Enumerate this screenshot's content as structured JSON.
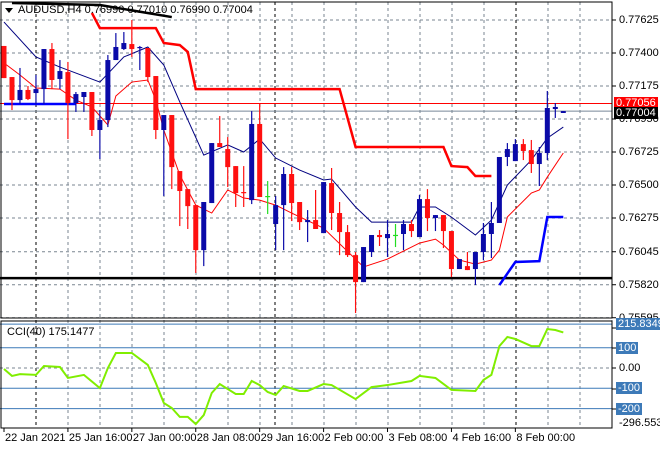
{
  "header": {
    "symbol_title": "AUDUSD,H4",
    "ohlc": "0.76990 0.77010 0.76990 0.77004"
  },
  "colors": {
    "bull": "#0a0aa8",
    "bear": "#ff1010",
    "doji": "#22dd22",
    "ma_fast": "#000080",
    "ma_slow": "#ff0000",
    "cci": "#80ee00",
    "level": "#3d7ab8",
    "grid": "#7a8590"
  },
  "price_axis": {
    "ticks": [
      "0.77625",
      "0.77400",
      "0.77175",
      "0.76950",
      "0.76725",
      "0.76500",
      "0.76275",
      "0.76045",
      "0.75820",
      "0.75595"
    ],
    "tick_values": [
      0.77625,
      0.774,
      0.77175,
      0.7695,
      0.76725,
      0.765,
      0.76275,
      0.76045,
      0.7582,
      0.75595
    ],
    "ask_line": {
      "label": "0.77056",
      "value": 0.77056
    },
    "bid_line": {
      "label": "0.77004",
      "value": 0.77004
    },
    "support_line": 0.75865
  },
  "candles": [
    [
      0.77448,
      0.77448,
      0.77229,
      0.77229
    ],
    [
      0.77236,
      0.77236,
      0.77011,
      0.77079
    ],
    [
      0.77079,
      0.77298,
      0.77052,
      0.77148
    ],
    [
      0.77148,
      0.77175,
      0.77079,
      0.77086
    ],
    [
      0.77127,
      0.7725,
      0.77052,
      0.77154
    ],
    [
      0.77154,
      0.77427,
      0.77052,
      0.77427
    ],
    [
      0.77427,
      0.77468,
      0.77154,
      0.77216
    ],
    [
      0.77223,
      0.77352,
      0.77154,
      0.77277
    ],
    [
      0.7727,
      0.77339,
      0.76813,
      0.77059
    ],
    [
      0.77059,
      0.77134,
      0.76998,
      0.7712
    ],
    [
      0.771,
      0.77134,
      0.76998,
      0.77134
    ],
    [
      0.77134,
      0.77134,
      0.76834,
      0.76875
    ],
    [
      0.76875,
      0.77011,
      0.76677,
      0.76943
    ],
    [
      0.76943,
      0.77386,
      0.76895,
      0.77352
    ],
    [
      0.77352,
      0.77536,
      0.77352,
      0.77441
    ],
    [
      0.77427,
      0.77543,
      0.7742,
      0.77468
    ],
    [
      0.77461,
      0.77625,
      0.77373,
      0.77427
    ],
    [
      0.77434,
      0.77448,
      0.77284,
      0.77441
    ],
    [
      0.77434,
      0.77434,
      0.77202,
      0.77236
    ],
    [
      0.77243,
      0.77243,
      0.76813,
      0.76875
    ],
    [
      0.76875,
      0.76977,
      0.76425,
      0.76977
    ],
    [
      0.76977,
      0.76977,
      0.76472,
      0.76622
    ],
    [
      0.76595,
      0.76595,
      0.7622,
      0.76459
    ],
    [
      0.76472,
      0.76472,
      0.762,
      0.76356
    ],
    [
      0.76363,
      0.76363,
      0.759,
      0.76056
    ],
    [
      0.76056,
      0.76384,
      0.75947,
      0.76384
    ],
    [
      0.76377,
      0.76786,
      0.76377,
      0.76786
    ],
    [
      0.76786,
      0.7697,
      0.76759,
      0.76759
    ],
    [
      0.76745,
      0.76827,
      0.76486,
      0.76622
    ],
    [
      0.76629,
      0.76629,
      0.7635,
      0.76445
    ],
    [
      0.76452,
      0.76629,
      0.7635,
      0.76445
    ],
    [
      0.76397,
      0.77004,
      0.7637,
      0.76916
    ],
    [
      0.76916,
      0.77052,
      0.76418,
      0.76418
    ],
    [
      0.76425,
      0.76527,
      0.76302,
      0.76425
    ],
    [
      0.76234,
      0.76425,
      0.76056,
      0.76363
    ],
    [
      0.76363,
      0.76622,
      0.76056,
      0.76575
    ],
    [
      0.76575,
      0.76622,
      0.76254,
      0.76377
    ],
    [
      0.76384,
      0.76384,
      0.76193,
      0.76247
    ],
    [
      0.76247,
      0.76329,
      0.76111,
      0.76261
    ],
    [
      0.76261,
      0.76466,
      0.762,
      0.762
    ],
    [
      0.76172,
      0.7652,
      0.76172,
      0.7652
    ],
    [
      0.76513,
      0.76616,
      0.76193,
      0.76309
    ],
    [
      0.76309,
      0.76384,
      0.76022,
      0.76179
    ],
    [
      0.76179,
      0.76227,
      0.76009,
      0.76022
    ],
    [
      0.76022,
      0.76043,
      0.75627,
      0.75838
    ],
    [
      0.75838,
      0.76077,
      0.75838,
      0.76077
    ],
    [
      0.76043,
      0.76159,
      0.76009,
      0.76159
    ],
    [
      0.76159,
      0.76193,
      0.76084,
      0.76145
    ],
    [
      0.76138,
      0.76261,
      0.76009,
      0.76166
    ],
    [
      0.7616,
      0.76234,
      0.76077,
      0.7616
    ],
    [
      0.76166,
      0.76261,
      0.76056,
      0.76234
    ],
    [
      0.76234,
      0.76261,
      0.76145,
      0.76186
    ],
    [
      0.76145,
      0.76432,
      0.76145,
      0.76404
    ],
    [
      0.76404,
      0.76472,
      0.76186,
      0.76275
    ],
    [
      0.76275,
      0.76295,
      0.76186,
      0.76295
    ],
    [
      0.76295,
      0.76295,
      0.7607,
      0.76186
    ],
    [
      0.76186,
      0.76186,
      0.75872,
      0.75927
    ],
    [
      0.75927,
      0.75995,
      0.75927,
      0.75995
    ],
    [
      0.75947,
      0.76043,
      0.7592,
      0.7592
    ],
    [
      0.75927,
      0.76043,
      0.75818,
      0.76043
    ],
    [
      0.76043,
      0.76241,
      0.75988,
      0.76166
    ],
    [
      0.76166,
      0.76384,
      0.76002,
      0.76241
    ],
    [
      0.76241,
      0.76691,
      0.76241,
      0.76691
    ],
    [
      0.76691,
      0.76786,
      0.76629,
      0.76745
    ],
    [
      0.76663,
      0.76813,
      0.76663,
      0.76779
    ],
    [
      0.76779,
      0.76813,
      0.7667,
      0.76732
    ],
    [
      0.76738,
      0.76807,
      0.76582,
      0.76643
    ],
    [
      0.76643,
      0.76759,
      0.76493,
      0.76718
    ],
    [
      0.76718,
      0.77141,
      0.7667,
      0.77025
    ],
    [
      0.77018,
      0.77059,
      0.76957,
      0.77032
    ],
    [
      0.76991,
      0.77004,
      0.76991,
      0.77004
    ]
  ],
  "ma_fast": [
    [
      0,
      0.77611
    ],
    [
      4,
      0.77373
    ],
    [
      7,
      0.77304
    ],
    [
      12,
      0.77202
    ],
    [
      15,
      0.77373
    ],
    [
      18,
      0.77441
    ],
    [
      20,
      0.77318
    ],
    [
      22,
      0.77066
    ],
    [
      25,
      0.76704
    ],
    [
      28,
      0.76773
    ],
    [
      30,
      0.76725
    ],
    [
      32,
      0.76813
    ],
    [
      34,
      0.76684
    ],
    [
      37,
      0.76602
    ],
    [
      40,
      0.76534
    ],
    [
      41,
      0.76541
    ],
    [
      44,
      0.7635
    ],
    [
      46,
      0.76247
    ],
    [
      51,
      0.76247
    ],
    [
      52,
      0.7635
    ],
    [
      54,
      0.7635
    ],
    [
      56,
      0.76281
    ],
    [
      59,
      0.76159
    ],
    [
      61,
      0.76261
    ],
    [
      63,
      0.765
    ],
    [
      66,
      0.7667
    ],
    [
      68,
      0.7682
    ],
    [
      70,
      0.76895
    ]
  ],
  "ma_slow": [
    [
      0,
      0.77332
    ],
    [
      2,
      0.7725
    ],
    [
      4,
      0.77161
    ],
    [
      7,
      0.77154
    ],
    [
      9,
      0.77079
    ],
    [
      11,
      0.77032
    ],
    [
      13,
      0.76909
    ],
    [
      14,
      0.77107
    ],
    [
      16,
      0.77202
    ],
    [
      18,
      0.77216
    ],
    [
      19,
      0.77079
    ],
    [
      20,
      0.76875
    ],
    [
      22,
      0.76568
    ],
    [
      24,
      0.76363
    ],
    [
      26,
      0.76309
    ],
    [
      28,
      0.76466
    ],
    [
      30,
      0.76411
    ],
    [
      32,
      0.76397
    ],
    [
      34,
      0.76363
    ],
    [
      36,
      0.76309
    ],
    [
      40,
      0.76206
    ],
    [
      45,
      0.75941
    ],
    [
      48,
      0.75995
    ],
    [
      52,
      0.76104
    ],
    [
      54,
      0.76131
    ],
    [
      55,
      0.76091
    ],
    [
      57,
      0.75988
    ],
    [
      59,
      0.75961
    ],
    [
      61,
      0.75988
    ],
    [
      62,
      0.76056
    ],
    [
      63,
      0.76282
    ],
    [
      66,
      0.76445
    ],
    [
      67,
      0.76466
    ],
    [
      68,
      0.76554
    ],
    [
      70,
      0.76718
    ]
  ],
  "resistance_steps": [
    [
      11,
      0.77673
    ],
    [
      12,
      0.7757
    ],
    [
      19,
      0.7757
    ],
    [
      20,
      0.77468
    ],
    [
      22,
      0.77454
    ],
    [
      23,
      0.77407
    ],
    [
      24,
      0.77154
    ],
    [
      42,
      0.77154
    ],
    [
      44,
      0.76759
    ],
    [
      55,
      0.76759
    ],
    [
      56,
      0.76629
    ],
    [
      58,
      0.76622
    ],
    [
      59,
      0.76561
    ],
    [
      61,
      0.76561
    ]
  ],
  "support_steps_left": [
    [
      0,
      0.77052
    ],
    [
      9,
      0.77052
    ]
  ],
  "support_steps_right": [
    [
      62,
      0.75818
    ],
    [
      64,
      0.75975
    ],
    [
      67,
      0.75981
    ],
    [
      68,
      0.76282
    ],
    [
      70,
      0.76282
    ]
  ],
  "zigzag": [
    [
      1,
      0.77741
    ],
    [
      12,
      0.77727
    ],
    [
      21,
      0.77645
    ]
  ],
  "cci": {
    "title": "CCI(40) 175.1477",
    "axis_labels": {
      "max": "215.8349",
      "p100": "100",
      "zero": "0.00",
      "m100": "-100",
      "m200": "-200",
      "min": "-296.553"
    },
    "levels": [
      215.8349,
      100,
      -100,
      -200
    ],
    "points": [
      [
        0,
        -5
      ],
      [
        1,
        -39
      ],
      [
        2,
        -30
      ],
      [
        4,
        -34
      ],
      [
        5,
        10
      ],
      [
        7,
        5
      ],
      [
        8,
        -49
      ],
      [
        10,
        -34
      ],
      [
        12,
        -99
      ],
      [
        13,
        0
      ],
      [
        14,
        74
      ],
      [
        16,
        74
      ],
      [
        18,
        15
      ],
      [
        19,
        -74
      ],
      [
        20,
        -172
      ],
      [
        21,
        -197
      ],
      [
        22,
        -241
      ],
      [
        23,
        -241
      ],
      [
        24,
        -276
      ],
      [
        25,
        -232
      ],
      [
        26,
        -123
      ],
      [
        27,
        -79
      ],
      [
        29,
        -128
      ],
      [
        30,
        -128
      ],
      [
        31,
        -64
      ],
      [
        32,
        -84
      ],
      [
        33,
        -118
      ],
      [
        34,
        -133
      ],
      [
        35,
        -89
      ],
      [
        37,
        -113
      ],
      [
        38,
        -113
      ],
      [
        40,
        -79
      ],
      [
        41,
        -84
      ],
      [
        44,
        -153
      ],
      [
        46,
        -94
      ],
      [
        48,
        -84
      ],
      [
        51,
        -64
      ],
      [
        52,
        -39
      ],
      [
        54,
        -49
      ],
      [
        56,
        -108
      ],
      [
        59,
        -113
      ],
      [
        60,
        -59
      ],
      [
        61,
        -34
      ],
      [
        62,
        108
      ],
      [
        63,
        153
      ],
      [
        64,
        143
      ],
      [
        66,
        108
      ],
      [
        67,
        108
      ],
      [
        68,
        192
      ],
      [
        69,
        187
      ],
      [
        70,
        175
      ]
    ]
  },
  "time_axis": {
    "labels": [
      "22 Jan 2021",
      "25 Jan 16:00",
      "27 Jan 00:00",
      "28 Jan 08:00",
      "29 Jan 16:00",
      "2 Feb 00:00",
      "3 Feb 08:00",
      "4 Feb 16:00",
      "8 Feb 00:00"
    ],
    "label_bar_index": [
      0,
      8,
      16,
      24,
      32,
      40,
      48,
      56,
      64
    ]
  }
}
